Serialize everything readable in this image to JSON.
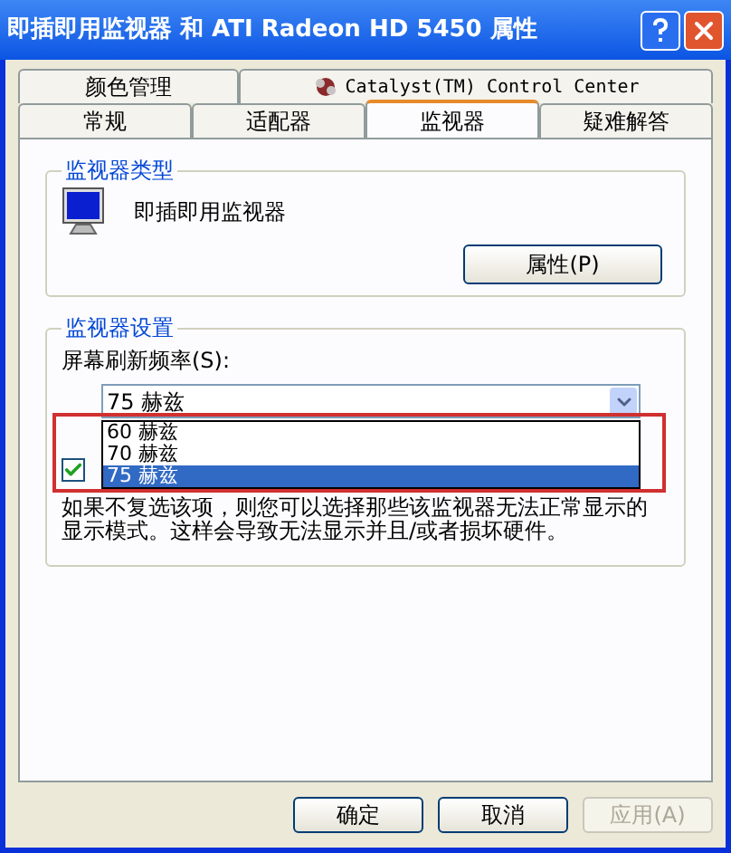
{
  "window": {
    "title": "即插即用监视器 和 ATI Radeon HD 5450 属性"
  },
  "tab_rows": [
    [
      {
        "label": "颜色管理",
        "selected": false,
        "kind": "plain"
      },
      {
        "label": "Catalyst(TM) Control Center",
        "selected": false,
        "kind": "icon"
      }
    ],
    [
      {
        "label": "常规",
        "selected": false,
        "kind": "plain"
      },
      {
        "label": "适配器",
        "selected": false,
        "kind": "plain"
      },
      {
        "label": "监视器",
        "selected": true,
        "kind": "plain"
      },
      {
        "label": "疑难解答",
        "selected": false,
        "kind": "plain"
      }
    ]
  ],
  "monitor_type": {
    "title": "监视器类型",
    "monitor_name": "即插即用监视器",
    "properties_button": "属性(P)"
  },
  "monitor_settings": {
    "title": "监视器设置",
    "refresh_label": "屏幕刷新频率(S):",
    "refresh_value": "75 赫兹",
    "dropdown_expanded": true,
    "options": [
      {
        "label": "60 赫兹",
        "selected": false
      },
      {
        "label": "70 赫兹",
        "selected": false
      },
      {
        "label": "75 赫兹",
        "selected": true
      }
    ],
    "hide_modes_checked": true,
    "note": "如果不复选该项，则您可以选择那些该监视器无法正常显示的显示模式。这样会导致无法显示并且/或者损坏硬件。"
  },
  "annotations": [
    {
      "kind": "rectangle",
      "color": "#d03030"
    }
  ],
  "buttons": [
    {
      "label": "确定",
      "disabled": false
    },
    {
      "label": "取消",
      "disabled": false
    },
    {
      "label": "应用(A)",
      "disabled": true
    }
  ]
}
